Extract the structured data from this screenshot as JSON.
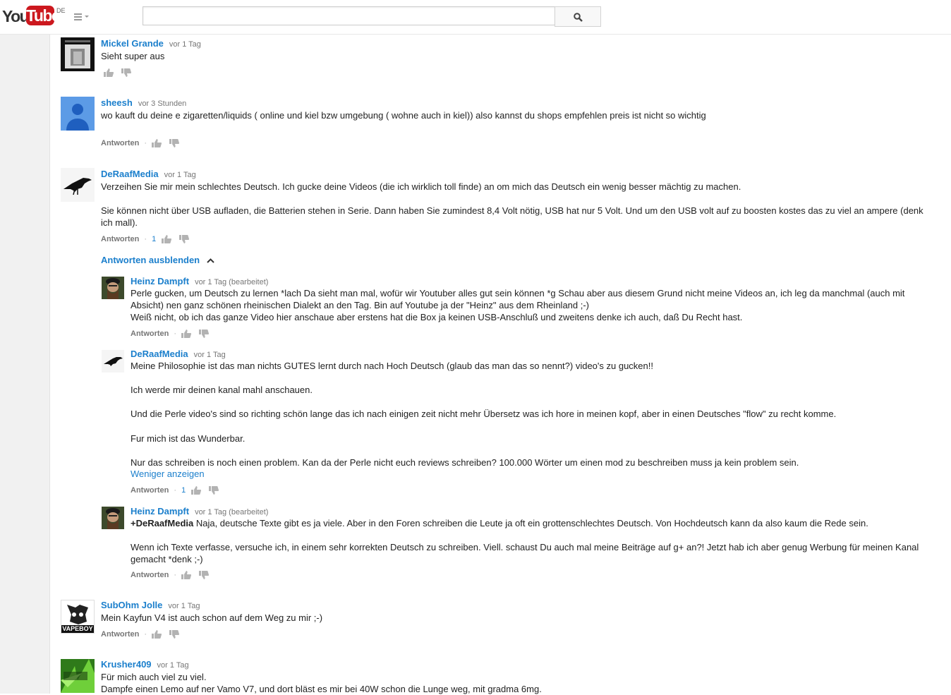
{
  "header": {
    "logo_you": "You",
    "logo_tube": "Tube",
    "region": "DE",
    "search_placeholder": ""
  },
  "comments": [
    {
      "author": "Mickel Grande",
      "time": "vor 1 Tag",
      "lines": [
        "Sieht super aus"
      ]
    },
    {
      "author": "sheesh",
      "time": "vor 3 Stunden",
      "lines": [
        "wo kauft du deine e zigaretten/liquids ( online und kiel bzw umgebung ( wohne auch in kiel)) also kannst du shops empfehlen preis ist nicht so wichtig"
      ],
      "reply_label": "Antworten"
    },
    {
      "author": "DeRaafMedia",
      "time": "vor 1 Tag",
      "lines": [
        "Verzeihen Sie mir mein schlechtes Deutsch. Ich gucke deine Videos (die ich wirklich toll finde) an om mich das Deutsch ein wenig besser mächtig zu machen.",
        "Sie können nicht über USB aufladen, die Batterien stehen in Serie. Dann haben Sie zumindest 8,4 Volt nötig, USB hat nur 5 Volt. Und um den USB volt auf zu boosten kostes das zu viel an ampere (denk",
        "ich mall)."
      ],
      "reply_label": "Antworten",
      "like_count": "1",
      "hide_replies": "Antworten ausblenden",
      "replies": [
        {
          "author": "Heinz Dampft",
          "time": "vor 1 Tag (bearbeitet)",
          "lines": [
            "Perle gucken, um Deutsch zu lernen *lach Da sieht man mal, wofür wir Youtuber alles gut sein können *g Schau aber aus diesem Grund nicht meine Videos an, ich leg da manchmal (auch mit",
            "Absicht) nen ganz schönen rheinischen Dialekt an den Tag. Bin auf Youtube ja der \"Heinz\" aus dem Rheinland ;-)",
            "Weiß nicht, ob ich das ganze Video hier anschaue aber erstens hat die Box ja keinen USB-Anschluß und zweitens denke ich auch, daß Du Recht hast."
          ],
          "reply_label": "Antworten"
        },
        {
          "author": "DeRaafMedia",
          "time": "vor 1 Tag",
          "lines": [
            "Meine Philosophie ist das man nichts GUTES lernt durch nach Hoch Deutsch (glaub das man das so nennt?) video's zu gucken!!",
            "Ich werde mir deinen kanal mahl anschauen.",
            "Und die Perle video's sind so richting schön lange das ich nach einigen zeit nicht mehr Übersetz was ich hore in meinen kopf, aber in einen Deutsches \"flow\" zu recht komme.",
            "Fur mich ist das Wunderbar.",
            "Nur das schreiben is noch einen problem. Kan da der Perle nicht euch reviews schreiben? 100.000 Wörter um einen mod zu beschreiben muss ja kein problem sein."
          ],
          "show_less": "Weniger anzeigen",
          "reply_label": "Antworten",
          "like_count": "1"
        },
        {
          "author": "Heinz Dampft",
          "time": "vor 1 Tag (bearbeitet)",
          "mention": "+DeRaafMedia",
          "lines": [
            " Naja, deutsche Texte gibt es ja viele. Aber in den Foren schreiben die Leute ja oft ein grottenschlechtes Deutsch. Von Hochdeutsch kann da also kaum die Rede sein.",
            "Wenn ich Texte verfasse, versuche ich, in einem sehr korrekten Deutsch zu schreiben. Viell. schaust Du auch mal meine Beiträge auf g+ an?! Jetzt hab ich aber genug Werbung für meinen Kanal",
            "gemacht *denk ;-)"
          ],
          "reply_label": "Antworten"
        }
      ]
    },
    {
      "author": "SubOhm Jolle",
      "time": "vor 1 Tag",
      "lines": [
        "Mein Kayfun V4 ist auch schon auf dem Weg zu mir ;-)"
      ],
      "reply_label": "Antworten",
      "avatar_text": "VAPEBOY"
    },
    {
      "author": "Krusher409",
      "time": "vor 1 Tag",
      "lines": [
        "Für mich auch viel zu viel.",
        "Dampfe einen Lemo auf ner Vamo V7, und dort bläst es mir bei 40W schon die Lunge weg, mit gradma 6mg."
      ]
    }
  ],
  "colors": {
    "link": "#1b7fcc",
    "text": "#222222",
    "meta": "#767676",
    "logo_red": "#cc181e",
    "guide_bg": "#f1f1f1"
  }
}
